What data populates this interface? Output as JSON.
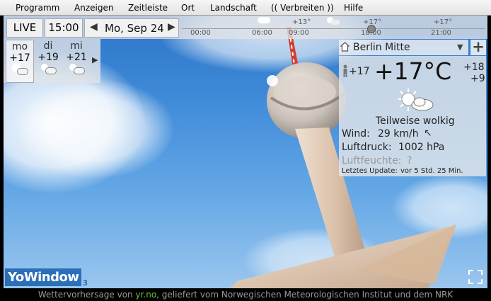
{
  "menu": [
    "Programm",
    "Anzeigen",
    "Zeitleiste",
    "Ort",
    "Landschaft",
    "(( Verbreiten ))",
    "Hilfe"
  ],
  "topbar": {
    "live": "LIVE",
    "time": "15:00",
    "date": "Mo, Sep 24",
    "timeline_hours": [
      "00:00",
      "06:00",
      "09:00",
      "18:00",
      "21:00"
    ],
    "timeline_temps": [
      "+13°",
      "+17°",
      "+17°"
    ]
  },
  "forecast": [
    {
      "day": "mo",
      "temp": "+17"
    },
    {
      "day": "di",
      "temp": "+19"
    },
    {
      "day": "mi",
      "temp": "+21"
    }
  ],
  "location": {
    "name": "Berlin Mitte"
  },
  "current": {
    "feels": "+17",
    "temp": "+17°C",
    "high": "+18",
    "low": "+9",
    "condition": "Teilweise wolkig",
    "wind_label": "Wind:",
    "wind_value": "29 km/h",
    "pressure_label": "Luftdruck:",
    "pressure_value": "1002 hPa",
    "humidity_label": "Luftfeuchte:",
    "humidity_value": "?",
    "update_label": "Letztes Update:",
    "update_value": "vor 5 Std. 25 Min."
  },
  "logo": {
    "text": "YoWindow",
    "version": "3"
  },
  "footer": {
    "prefix": "Wettervorhersage von ",
    "link": "yr.no",
    "suffix": ", geliefert vom Norwegischen Meteorologischen Institut und dem NRK"
  },
  "colors": {
    "accent": "#2b6fb8",
    "link": "#6bbf3b"
  }
}
